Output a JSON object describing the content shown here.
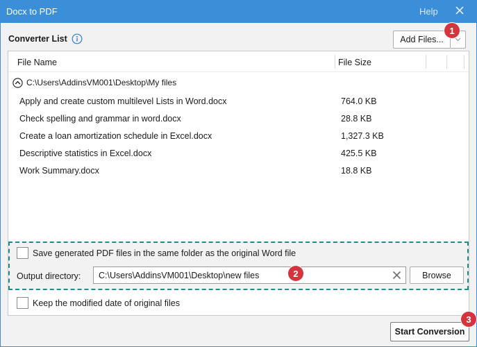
{
  "window": {
    "title": "Docx to PDF",
    "help_label": "Help",
    "titlebar_color": "#3b8fd9"
  },
  "converter_list": {
    "title": "Converter List",
    "add_files_label": "Add Files...",
    "columns": {
      "name": "File Name",
      "size": "File Size"
    },
    "folder_path": "C:\\Users\\AddinsVM001\\Desktop\\My files",
    "files": [
      {
        "name": "Apply and create custom multilevel Lists in Word.docx",
        "size": "764.0 KB"
      },
      {
        "name": "Check spelling and grammar in word.docx",
        "size": "28.8 KB"
      },
      {
        "name": "Create a loan amortization schedule in Excel.docx",
        "size": "1,327.3 KB"
      },
      {
        "name": "Descriptive statistics in Excel.docx",
        "size": "425.5 KB"
      },
      {
        "name": "Work Summary.docx",
        "size": "18.8 KB"
      }
    ]
  },
  "options": {
    "same_folder_label": "Save generated PDF files in the same folder as the original Word file",
    "same_folder_checked": false,
    "output_directory_label": "Output directory:",
    "output_directory_value": "C:\\Users\\AddinsVM001\\Desktop\\new files",
    "browse_label": "Browse",
    "keep_date_label": "Keep the modified date of original files",
    "keep_date_checked": false
  },
  "start_conversion_label": "Start Conversion",
  "badges": [
    "1",
    "2",
    "3"
  ],
  "badge_color": "#d3343e",
  "highlight_color": "#1f8a86"
}
